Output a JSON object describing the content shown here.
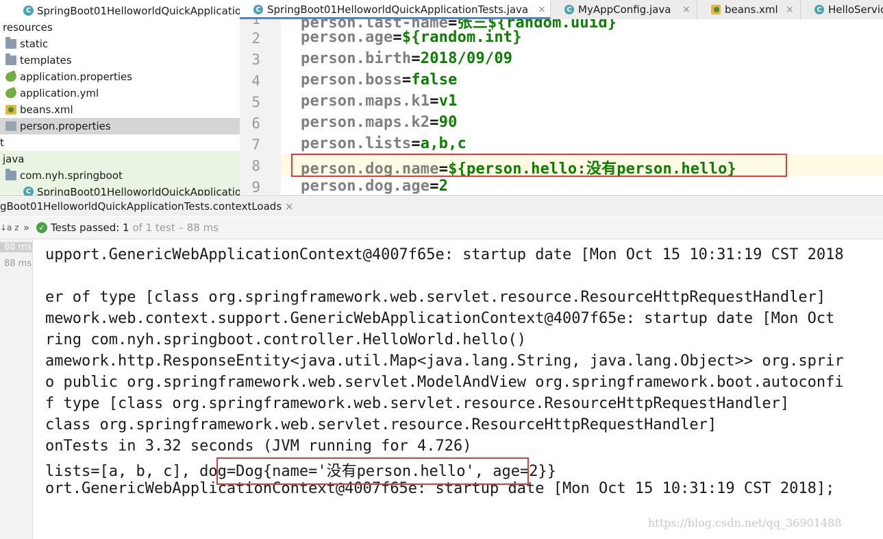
{
  "project_tree": {
    "items": [
      {
        "label": "SpringBoot01HelloworldQuickApplicatio",
        "icon": "class-icon"
      },
      {
        "label": "resources",
        "icon": "none"
      },
      {
        "label": "static",
        "icon": "folder-icon"
      },
      {
        "label": "templates",
        "icon": "folder-icon"
      },
      {
        "label": "application.properties",
        "icon": "spring-leaf-icon"
      },
      {
        "label": "application.yml",
        "icon": "spring-leaf-icon"
      },
      {
        "label": "beans.xml",
        "icon": "xml-icon"
      },
      {
        "label": "person.properties",
        "icon": "properties-icon"
      },
      {
        "label": "t",
        "icon": "none"
      },
      {
        "label": "java",
        "icon": "none"
      },
      {
        "label": "com.nyh.springboot",
        "icon": "folder-icon"
      },
      {
        "label": "SpringBoot01HelloworldQuickApplicatio",
        "icon": "class-icon"
      }
    ]
  },
  "tabs": [
    {
      "label": "SpringBoot01HelloworldQuickApplicationTests.java",
      "icon": "class-icon",
      "close": "×",
      "active": true
    },
    {
      "label": "MyAppConfig.java",
      "icon": "class-icon",
      "close": "×",
      "active": false
    },
    {
      "label": "beans.xml",
      "icon": "xml-icon",
      "close": "×",
      "active": false
    },
    {
      "label": "HelloServic",
      "icon": "class-icon",
      "close": "",
      "active": false
    }
  ],
  "editor": {
    "lines": [
      {
        "num": "1",
        "key": "person.last-name",
        "eq": "=",
        "val": "张三${random.uuid}"
      },
      {
        "num": "2",
        "key": "person.age",
        "eq": "=",
        "val": "${random.int}"
      },
      {
        "num": "3",
        "key": "person.birth",
        "eq": "=",
        "val": "2018/09/09"
      },
      {
        "num": "4",
        "key": "person.boss",
        "eq": "=",
        "val": "false"
      },
      {
        "num": "5",
        "key": "person.maps.k1",
        "eq": "=",
        "val": "v1"
      },
      {
        "num": "6",
        "key": "person.maps.k2",
        "eq": "=",
        "val": "90"
      },
      {
        "num": "7",
        "key": "person.lists",
        "eq": "=",
        "val": "a,b,c"
      },
      {
        "num": "8",
        "key": "person.dog.name",
        "eq": "=",
        "val": "${person.hello:没有person.hello}"
      },
      {
        "num": "9",
        "key": "person.dog.age",
        "eq": "=",
        "val": "2"
      }
    ]
  },
  "run_panel": {
    "title": "gBoot01HelloworldQuickApplicationTests.contextLoads",
    "title_close": "×",
    "sort_glyph": "↓a z",
    "expand_glyph": "»",
    "tests_label": "Tests passed: ",
    "tests_count": "1",
    "tests_detail": " of 1 test – 88 ms",
    "timings": [
      "88 ms",
      "88 ms"
    ]
  },
  "console": {
    "lines": [
      "upport.GenericWebApplicationContext@4007f65e: startup date [Mon Oct 15 10:31:19 CST 2018",
      "",
      "er of type [class org.springframework.web.servlet.resource.ResourceHttpRequestHandler]",
      "mework.web.context.support.GenericWebApplicationContext@4007f65e: startup date [Mon Oct",
      "ring com.nyh.springboot.controller.HelloWorld.hello()",
      "amework.http.ResponseEntity<java.util.Map<java.lang.String, java.lang.Object>> org.sprir",
      "o public org.springframework.web.servlet.ModelAndView org.springframework.boot.autoconfi",
      "f type [class org.springframework.web.servlet.resource.ResourceHttpRequestHandler]",
      "class org.springframework.web.servlet.resource.ResourceHttpRequestHandler]",
      "onTests in 3.32 seconds (JVM running for 4.726)",
      " lists=[a, b, c], dog=Dog{name='没有person.hello', age=2}}",
      "ort.GenericWebApplicationContext@4007f65e: startup date [Mon Oct 15 10:31:19 CST 2018];"
    ]
  },
  "watermark": "https://blog.csdn.net/qq_36901488",
  "colors": {
    "key": "#7f7f7f",
    "value": "#0b8000",
    "highlight_box": "#e03c3c",
    "tests_passed": "#4aa045"
  }
}
